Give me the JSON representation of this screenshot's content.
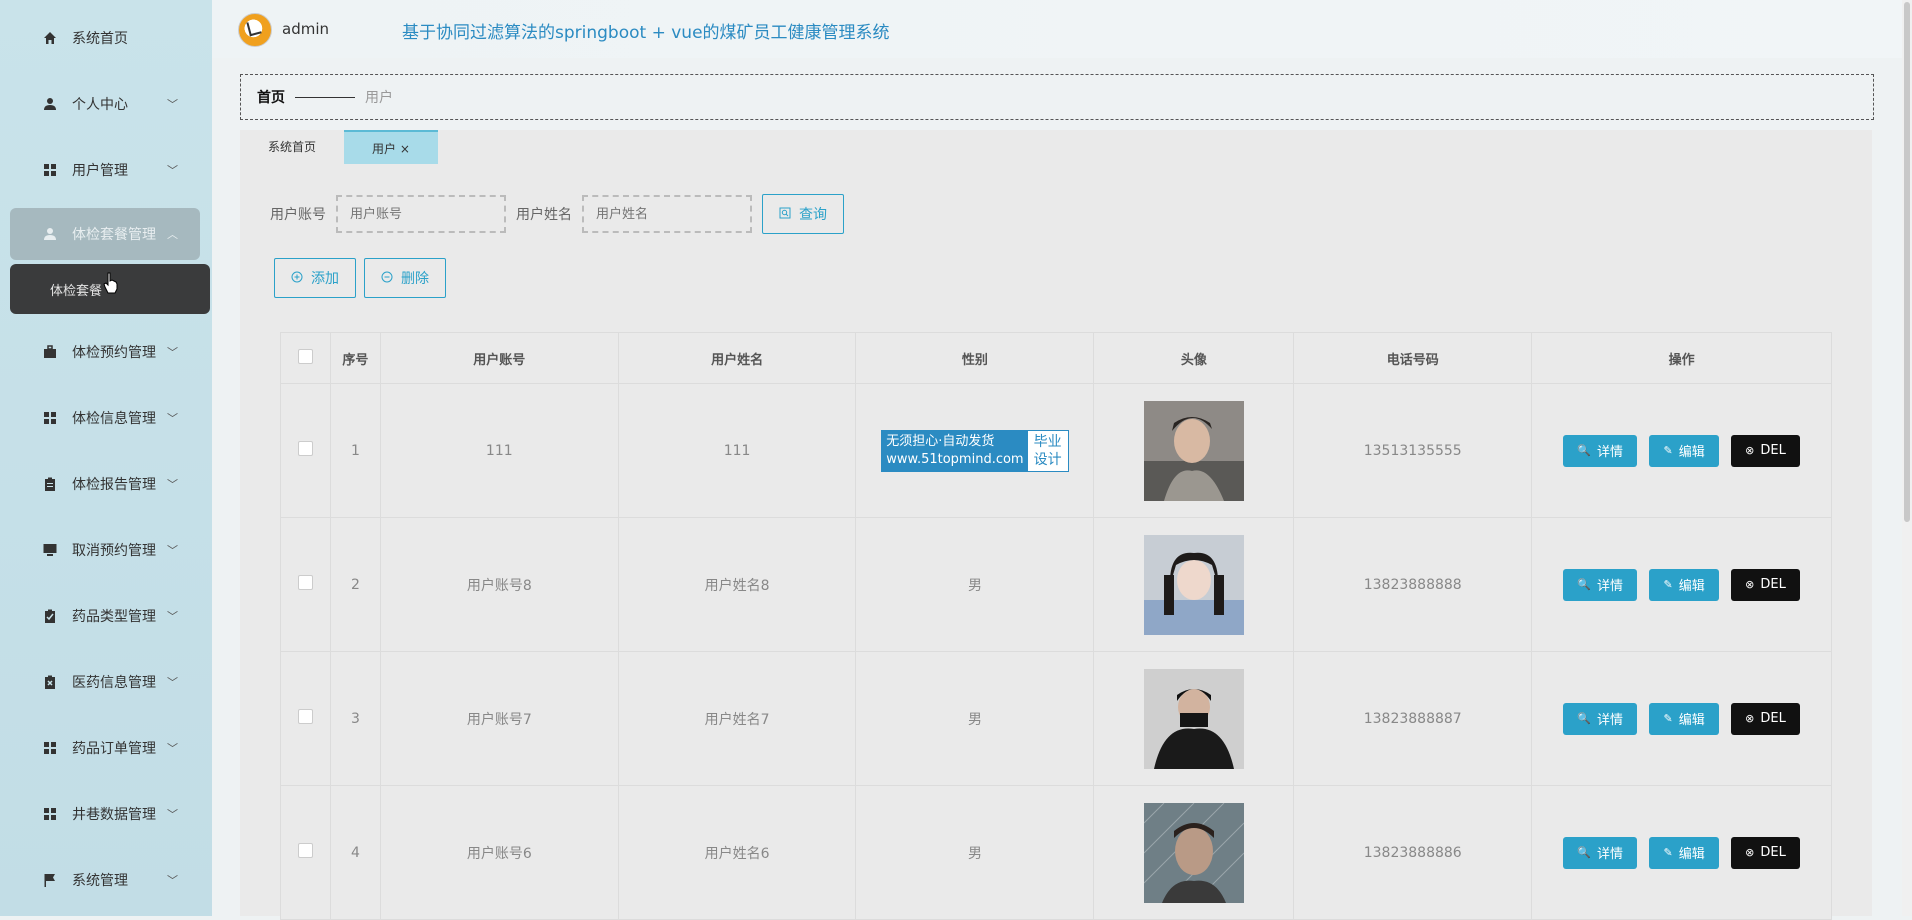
{
  "sidebar": {
    "items": [
      {
        "label": "系统首页",
        "icon": "home-icon"
      },
      {
        "label": "个人中心",
        "icon": "user-icon"
      },
      {
        "label": "用户管理",
        "icon": "grid-icon"
      },
      {
        "label": "体检套餐管理",
        "icon": "user-icon"
      },
      {
        "label": "体检预约管理",
        "icon": "briefcase-icon"
      },
      {
        "label": "体检信息管理",
        "icon": "grid-icon"
      },
      {
        "label": "体检报告管理",
        "icon": "clipboard-icon"
      },
      {
        "label": "取消预约管理",
        "icon": "monitor-icon"
      },
      {
        "label": "药品类型管理",
        "icon": "clipboard-check-icon"
      },
      {
        "label": "医药信息管理",
        "icon": "clipboard-x-icon"
      },
      {
        "label": "药品订单管理",
        "icon": "grid-icon"
      },
      {
        "label": "井巷数据管理",
        "icon": "grid-icon"
      },
      {
        "label": "系统管理",
        "icon": "flag-icon"
      }
    ],
    "submenu_label": "体检套餐"
  },
  "header": {
    "username": "admin",
    "title": "基于协同过滤算法的springboot + vue的煤矿员工健康管理系统"
  },
  "breadcrumb": {
    "home": "首页",
    "current": "用户"
  },
  "tabs": [
    {
      "label": "系统首页"
    },
    {
      "label": "用户 ×"
    }
  ],
  "search": {
    "account_label": "用户账号",
    "account_placeholder": "用户账号",
    "name_label": "用户姓名",
    "name_placeholder": "用户姓名",
    "query_label": "查询"
  },
  "actions": {
    "add_label": "添加",
    "delete_label": "删除"
  },
  "table": {
    "headers": [
      "序号",
      "用户账号",
      "用户姓名",
      "性别",
      "头像",
      "电话号码",
      "操作"
    ],
    "rows": [
      {
        "index": "1",
        "account": "111",
        "name": "111",
        "gender": "",
        "phone": "13513135555"
      },
      {
        "index": "2",
        "account": "用户账号8",
        "name": "用户姓名8",
        "gender": "男",
        "phone": "13823888888"
      },
      {
        "index": "3",
        "account": "用户账号7",
        "name": "用户姓名7",
        "gender": "男",
        "phone": "13823888887"
      },
      {
        "index": "4",
        "account": "用户账号6",
        "name": "用户姓名6",
        "gender": "男",
        "phone": "13823888886"
      }
    ],
    "detail_label": "详情",
    "edit_label": "编辑",
    "del_label": "DEL"
  },
  "watermark": {
    "line1": "无须担心·自动发货",
    "line2": "www.51topmind.com",
    "right1": "毕业",
    "right2": "设计"
  },
  "colors": {
    "accent": "#2ba1c9",
    "title": "#2b8bc2",
    "sidebar_bg": "#c9e3ea",
    "active_item": "#a6b9bf",
    "submenu_bg": "#3a3b3c",
    "del_button": "#111111"
  }
}
